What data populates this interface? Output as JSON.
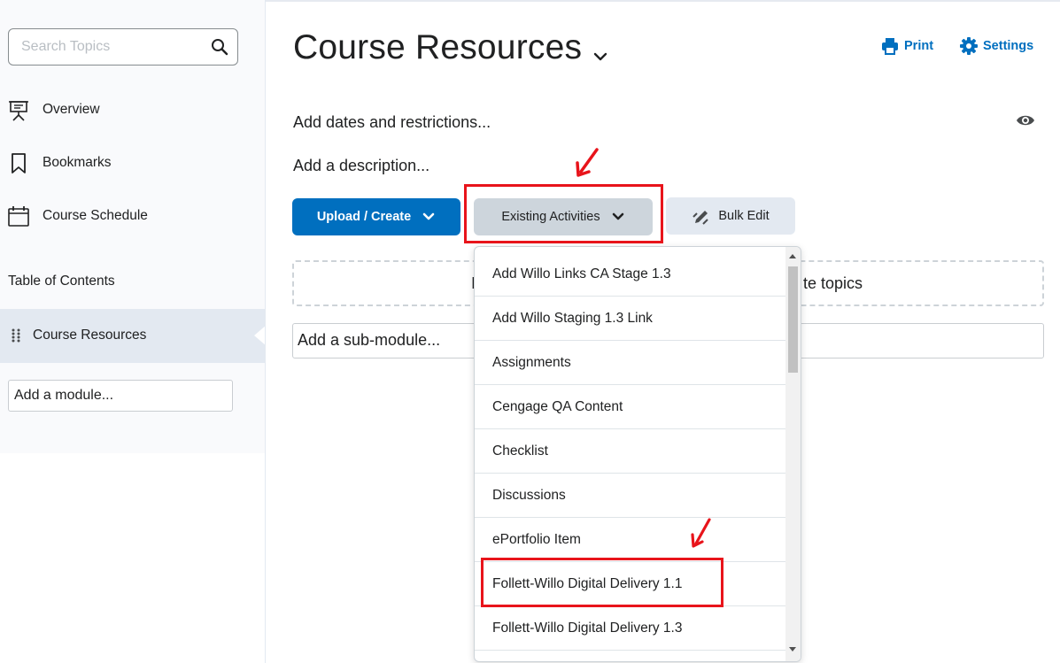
{
  "sidebar": {
    "search": {
      "placeholder": "Search Topics"
    },
    "nav": [
      {
        "label": "Overview",
        "icon": "presentation-icon"
      },
      {
        "label": "Bookmarks",
        "icon": "bookmark-icon"
      },
      {
        "label": "Course Schedule",
        "icon": "calendar-icon"
      }
    ],
    "toc_label": "Table of Contents",
    "active_module": "Course Resources",
    "add_module": "Add a module..."
  },
  "main": {
    "title": "Course Resources",
    "print_label": "Print",
    "settings_label": "Settings",
    "dates_label": "Add dates and restrictions...",
    "description_label": "Add a description...",
    "buttons": {
      "upload": "Upload / Create",
      "existing": "Existing Activities",
      "bulk_edit": "Bulk Edit"
    },
    "dropzone_left": "I",
    "dropzone_text": "te topics",
    "submodule": "Add a sub-module..."
  },
  "dropdown": {
    "items": [
      "Add Willo Links CA Stage 1.3",
      "Add Willo Staging 1.3 Link",
      "Assignments",
      "Cengage QA Content",
      "Checklist",
      "Discussions",
      "ePortfolio Item",
      "Follett-Willo Digital Delivery 1.1",
      "Follett-Willo Digital Delivery 1.3"
    ]
  },
  "colors": {
    "accent": "#006fbf",
    "highlight": "#e8141b",
    "active_bg": "#e3e9f1"
  }
}
